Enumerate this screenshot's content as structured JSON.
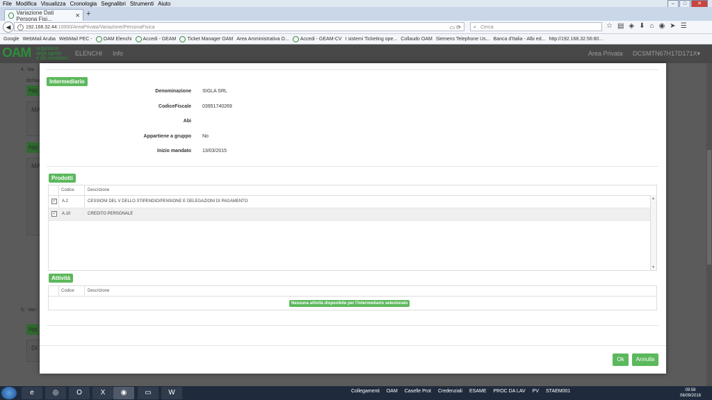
{
  "browser": {
    "menu": [
      "File",
      "Modifica",
      "Visualizza",
      "Cronologia",
      "Segnalibri",
      "Strumenti",
      "Aiuto"
    ],
    "tab_title": "Variazione Dati Persona Fisi...",
    "url_host": "192.168.32.44",
    "url_rest": ":10000/AreaPrivata/Variazione/PersonaFisica",
    "search_placeholder": "Cerca",
    "bookmarks": [
      "Google",
      "WebMail Aruba",
      "WebMail PEC -",
      "OAM Elenchi",
      "Accedi - GEAM",
      "Ticket Manager OAM",
      "Area Amministrativa O...",
      "Accedi - GEAM-CV",
      "I sistemi Ticketing ope...",
      "Collaudo OAM",
      "Siemens Telephone Us...",
      "Banca d'Italia - Albi ed...",
      "http://192.168.32.56:80..."
    ]
  },
  "site": {
    "logo": "OAM",
    "logo_lines": [
      "organismo",
      "degli agenti",
      "e dei mediatori"
    ],
    "nav": [
      "ELENCHI",
      "Info"
    ],
    "area_privata": "Area Privata",
    "user": "DCSMTN67H17D171X"
  },
  "background": {
    "item4_num": "4.",
    "item4_text": "Var",
    "dichia": "dichia",
    "agg1": "Agg",
    "ma1": "MA",
    "agg2": "Agg",
    "ma2": "MA",
    "item5_num": "5.",
    "item5_text": "Vari",
    "agg3": "Agg",
    "di": "DI"
  },
  "modal": {
    "intermediario": {
      "title": "Intermediario",
      "fields": [
        {
          "label": "Denominazione",
          "value": "SIGLA SRL"
        },
        {
          "label": "CodiceFiscale",
          "value": "03951740269"
        },
        {
          "label": "Abi",
          "value": ""
        },
        {
          "label": "Appartiene a gruppo",
          "value": "No"
        },
        {
          "label": "Inizio mandato",
          "value": "13/03/2015"
        }
      ]
    },
    "prodotti": {
      "title": "Prodotti",
      "col_codice": "Codice",
      "col_descrizione": "Descrizione",
      "rows": [
        {
          "checked": true,
          "codice": "A.2",
          "descrizione": "CESSIONI DEL V DELLO STIPENDIO/PENSIONE E DELEGAZIONI DI PAGAMENTO"
        },
        {
          "checked": true,
          "codice": "A.10",
          "descrizione": "CREDITO PERSONALE"
        }
      ]
    },
    "attivita": {
      "title": "Attività",
      "col_codice": "Codice",
      "col_descrizione": "Descrizione",
      "empty_message": "Nessuna attività disponibile per l'intermediario selezionato"
    },
    "ok_label": "Ok",
    "annulla_label": "Annulla"
  },
  "taskbar": {
    "tray": [
      "Collegamenti",
      "OAM",
      "Caselle Prot",
      "Credenziali",
      "ESAME",
      "PROC DA LAV",
      "PV",
      "STAEM001"
    ],
    "time": "09:58",
    "date": "06/09/2016"
  },
  "colors": {
    "accent_green": "#5cb85c",
    "header_dark": "#484848",
    "logo_green": "#2d8d3a"
  }
}
